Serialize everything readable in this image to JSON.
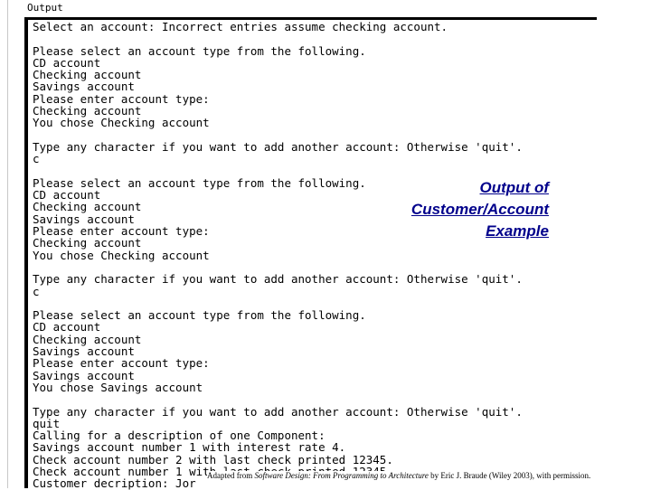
{
  "window": {
    "label": "Output"
  },
  "colors": {
    "callout": "#00008b",
    "border": "#000000",
    "background": "#ffffff",
    "console_text": "#000000"
  },
  "console": {
    "lines": [
      "Select an account: Incorrect entries assume checking account.",
      "",
      "Please select an account type from the following.",
      "CD account",
      "Checking account",
      "Savings account",
      "Please enter account type:",
      "Checking account",
      "You chose Checking account",
      "",
      "Type any character if you want to add another account: Otherwise 'quit'.",
      "c",
      "",
      "Please select an account type from the following.",
      "CD account",
      "Checking account",
      "Savings account",
      "Please enter account type:",
      "Checking account",
      "You chose Checking account",
      "",
      "Type any character if you want to add another account: Otherwise 'quit'.",
      "c",
      "",
      "Please select an account type from the following.",
      "CD account",
      "Checking account",
      "Savings account",
      "Please enter account type:",
      "Savings account",
      "You chose Savings account",
      "",
      "Type any character if you want to add another account: Otherwise 'quit'.",
      "quit",
      "Calling for a description of one Component:",
      "Savings account number 1 with interest rate 4.",
      "Check account number 2 with last check printed 12345.",
      "Check account number 1 with last check printed 12345.",
      "Customer decription: Jor"
    ]
  },
  "callout": {
    "line1": "Output of",
    "line2": "Customer/Account",
    "line3": "Example"
  },
  "attribution": {
    "prefix": "Adapted from ",
    "title": "Software Design: From Programming to Architecture",
    "suffix": " by Eric J. Braude (Wiley 2003), with permission."
  }
}
